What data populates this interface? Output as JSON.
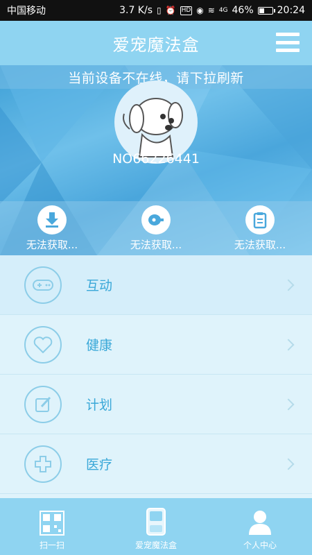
{
  "status_bar": {
    "carrier": "中国移动",
    "speed": "3.7 K/s",
    "icons": [
      "vibrate-icon",
      "alarm-icon",
      "hd-icon",
      "eye-icon",
      "wifi-icon",
      "signal-icon"
    ],
    "hd": "HD",
    "network": "4G",
    "battery": "46%",
    "battery_level": 0.46,
    "time": "20:24"
  },
  "header": {
    "title": "爱宠魔法盒",
    "menu_icon": "hamburger-menu-icon"
  },
  "hero": {
    "offline_message": "当前设备不在线，请下拉刷新",
    "device_id": "NO66226441",
    "avatar_icon": "cartoon-dog-icon",
    "stats": [
      {
        "icon": "download-icon",
        "label": "无法获取..."
      },
      {
        "icon": "meat-icon",
        "label": "无法获取..."
      },
      {
        "icon": "clipboard-icon",
        "label": "无法获取..."
      }
    ]
  },
  "menu": {
    "items": [
      {
        "icon": "gamepad-icon",
        "label": "互动"
      },
      {
        "icon": "heart-icon",
        "label": "健康"
      },
      {
        "icon": "edit-icon",
        "label": "计划"
      },
      {
        "icon": "medical-cross-icon",
        "label": "医疗"
      }
    ]
  },
  "bottom_nav": {
    "items": [
      {
        "icon": "qr-code-icon",
        "label": "扫一扫"
      },
      {
        "icon": "magic-box-icon",
        "label": "爱宠魔法盒"
      },
      {
        "icon": "person-icon",
        "label": "个人中心"
      }
    ]
  },
  "colors": {
    "header": "#8fd4f1",
    "accent_text": "#3aa8d8",
    "list_bg": "#dff3fb"
  }
}
